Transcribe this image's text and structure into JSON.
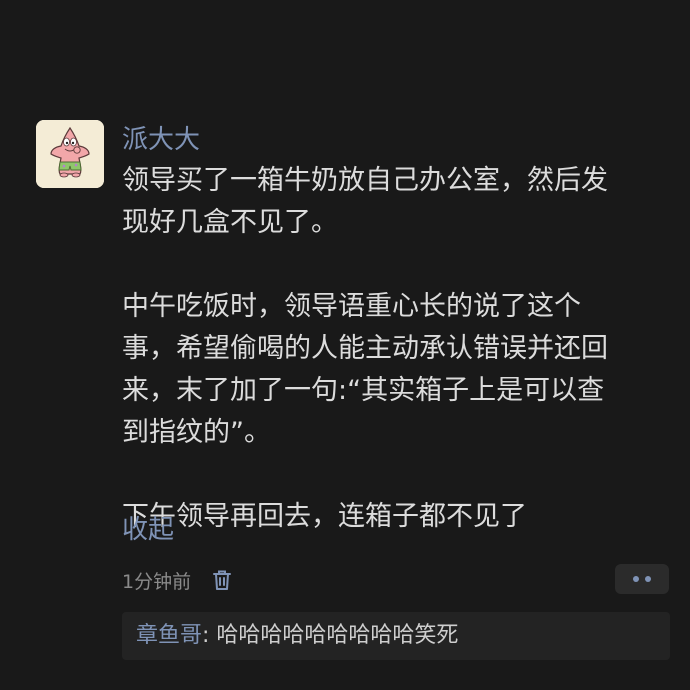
{
  "post": {
    "username": "派大大",
    "paragraphs": [
      "领导买了一箱牛奶放自己办公室，然后发\n现好几盒不见了。",
      "中午吃饭时，领导语重心长的说了这个\n事，希望偷喝的人能主动承认错误并还回\n来，末了加了一句:“其实箱子上是可以查\n到指纹的”。",
      "下午领导再回去，连箱子都不见了"
    ],
    "collapse_label": "收起",
    "time": "1分钟前",
    "avatar_icon": "patrick-star-avatar",
    "delete_icon": "trash-icon",
    "more_icon": "more-dots-icon"
  },
  "comments": [
    {
      "author": "章鱼哥",
      "separator": ": ",
      "text": "哈哈哈哈哈哈哈哈哈笑死"
    }
  ],
  "colors": {
    "background": "#191919",
    "link": "#7f93b6",
    "text": "#dcdcdc",
    "muted": "#8a8a8a",
    "comment_bg": "#232323"
  }
}
